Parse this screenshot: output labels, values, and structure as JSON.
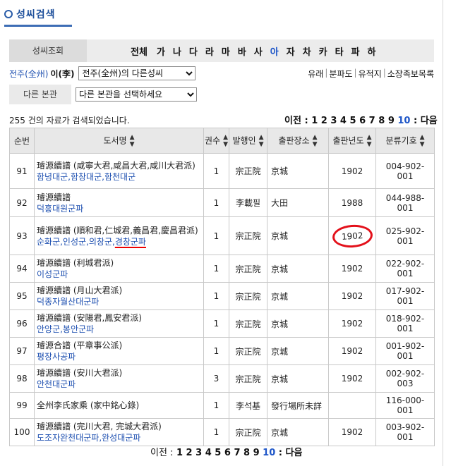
{
  "title": "성씨검색",
  "search_bar": {
    "label": "성씨조회",
    "letters": [
      "전체",
      "가",
      "나",
      "다",
      "라",
      "마",
      "바",
      "사",
      "아",
      "자",
      "차",
      "카",
      "타",
      "파",
      "하"
    ],
    "selected": "아"
  },
  "clan": {
    "origin": "전주(全州)",
    "surname": "이(李)",
    "dropdown_selected": "전주(全州)의 다른성씨",
    "links": [
      "유래",
      "분파도",
      "유적지",
      "소장족보목록"
    ]
  },
  "other_origin": {
    "label": "다른 본관",
    "dropdown_selected": "다른 본관을 선택하세요"
  },
  "result_count": "255 건의 자료가 검색되었습니다.",
  "pager": {
    "prev": "이전 :",
    "pages": [
      "1",
      "2",
      "3",
      "4",
      "5",
      "6",
      "7",
      "8",
      "9",
      "10"
    ],
    "current": "10",
    "next": ": 다음"
  },
  "table": {
    "headers": [
      "순번",
      "도서명",
      "권수",
      "발행인",
      "출판장소",
      "출판년도",
      "분류기호"
    ],
    "rows": [
      {
        "no": "91",
        "title": "璿源續譜 (咸寧大君,咸昌大君,咸川大君派)",
        "sub": "함녕대군,함창대군,함천대군",
        "vol": "1",
        "publisher": "宗正院",
        "place": "京城",
        "year": "1902",
        "code": "004-902-001"
      },
      {
        "no": "92",
        "title": "璿源續譜",
        "sub": "덕흥대원군파",
        "vol": "1",
        "publisher": "李載필",
        "place": "大田",
        "year": "1988",
        "code": "044-988-001"
      },
      {
        "no": "93",
        "title": "璿源續譜 (順和君,仁城君,義昌君,慶昌君派)",
        "sub": "순화군,인성군,의창군,경창군파",
        "vol": "1",
        "publisher": "宗正院",
        "place": "京城",
        "year": "1902",
        "code": "025-902-001"
      },
      {
        "no": "94",
        "title": "璿源續譜 (利城君派)",
        "sub": "이성군파",
        "vol": "1",
        "publisher": "宗正院",
        "place": "京城",
        "year": "1902",
        "code": "022-902-001"
      },
      {
        "no": "95",
        "title": "璿源續譜 (月山大君派)",
        "sub": "덕종자월산대군파",
        "vol": "1",
        "publisher": "宗正院",
        "place": "京城",
        "year": "1902",
        "code": "017-902-001"
      },
      {
        "no": "96",
        "title": "璿源續譜 (安陽君,鳳安君派)",
        "sub": "안양군,봉안군파",
        "vol": "1",
        "publisher": "宗正院",
        "place": "京城",
        "year": "1902",
        "code": "018-902-001"
      },
      {
        "no": "97",
        "title": "璿源合譜 (平章事公派)",
        "sub": "평장사공파",
        "vol": "1",
        "publisher": "宗正院",
        "place": "京城",
        "year": "1902",
        "code": "001-902-001"
      },
      {
        "no": "98",
        "title": "璿源續譜 (安川大君派)",
        "sub": "안천대군파",
        "vol": "3",
        "publisher": "宗正院",
        "place": "京城",
        "year": "1902",
        "code": "002-902-003"
      },
      {
        "no": "99",
        "title": "全州李氏家乘 (家中銘心錄)",
        "sub": "",
        "vol": "1",
        "publisher": "李석基",
        "place": "發行場所未詳",
        "year": "",
        "code": "116-000-001"
      },
      {
        "no": "100",
        "title": "璿源續譜 (完川大君, 完城大君派)",
        "sub": "도조자완천대군파,완성대군파",
        "vol": "1",
        "publisher": "宗正院",
        "place": "京城",
        "year": "1902",
        "code": "003-902-001"
      }
    ]
  }
}
